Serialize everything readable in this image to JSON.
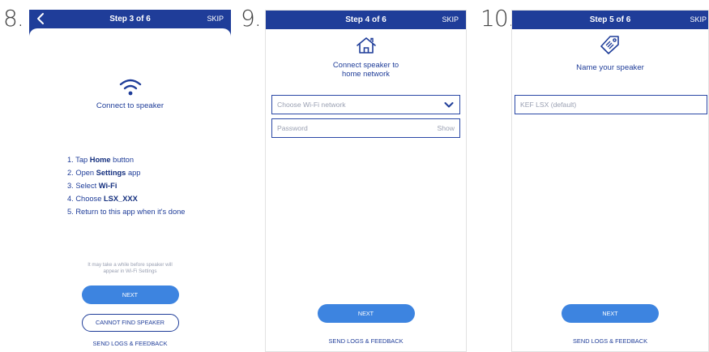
{
  "screens": [
    {
      "number": "8.",
      "title": "Step 3 of 6",
      "skip": "SKIP",
      "heading": "Connect to speaker",
      "icon": "wifi-icon",
      "instructions": [
        {
          "prefix": "1. Tap ",
          "bold": "Home",
          "suffix": " button"
        },
        {
          "prefix": "2. Open ",
          "bold": "Settings",
          "suffix": " app"
        },
        {
          "prefix": "3. Select ",
          "bold": "Wi-Fi",
          "suffix": ""
        },
        {
          "prefix": "4. Choose ",
          "bold": "LSX_XXX",
          "suffix": ""
        },
        {
          "prefix": "5. Return to this app when it's done",
          "bold": "",
          "suffix": ""
        }
      ],
      "note_line1": "It may take a while before speaker will",
      "note_line2": "appear in Wi-Fi Settings",
      "next": "NEXT",
      "cannot_find": "CANNOT FIND SPEAKER",
      "send_logs": "SEND LOGS & FEEDBACK"
    },
    {
      "number": "9.",
      "title": "Step 4 of 6",
      "skip": "SKIP",
      "icon": "home-icon",
      "heading_line1": "Connect speaker to",
      "heading_line2": "home network",
      "network_placeholder": "Choose Wi-Fi network",
      "password_placeholder": "Password",
      "show": "Show",
      "next": "NEXT",
      "send_logs": "SEND LOGS & FEEDBACK"
    },
    {
      "number": "10.",
      "title": "Step 5 of 6",
      "skip": "SKIP",
      "icon": "tag-icon",
      "heading": "Name your speaker",
      "name_placeholder": "KEF LSX (default)",
      "next": "NEXT",
      "send_logs": "SEND LOGS & FEEDBACK"
    }
  ],
  "colors": {
    "brand_blue": "#1f3d99",
    "button_blue": "#3d84e0",
    "placeholder_gray": "#9aa0b2"
  }
}
